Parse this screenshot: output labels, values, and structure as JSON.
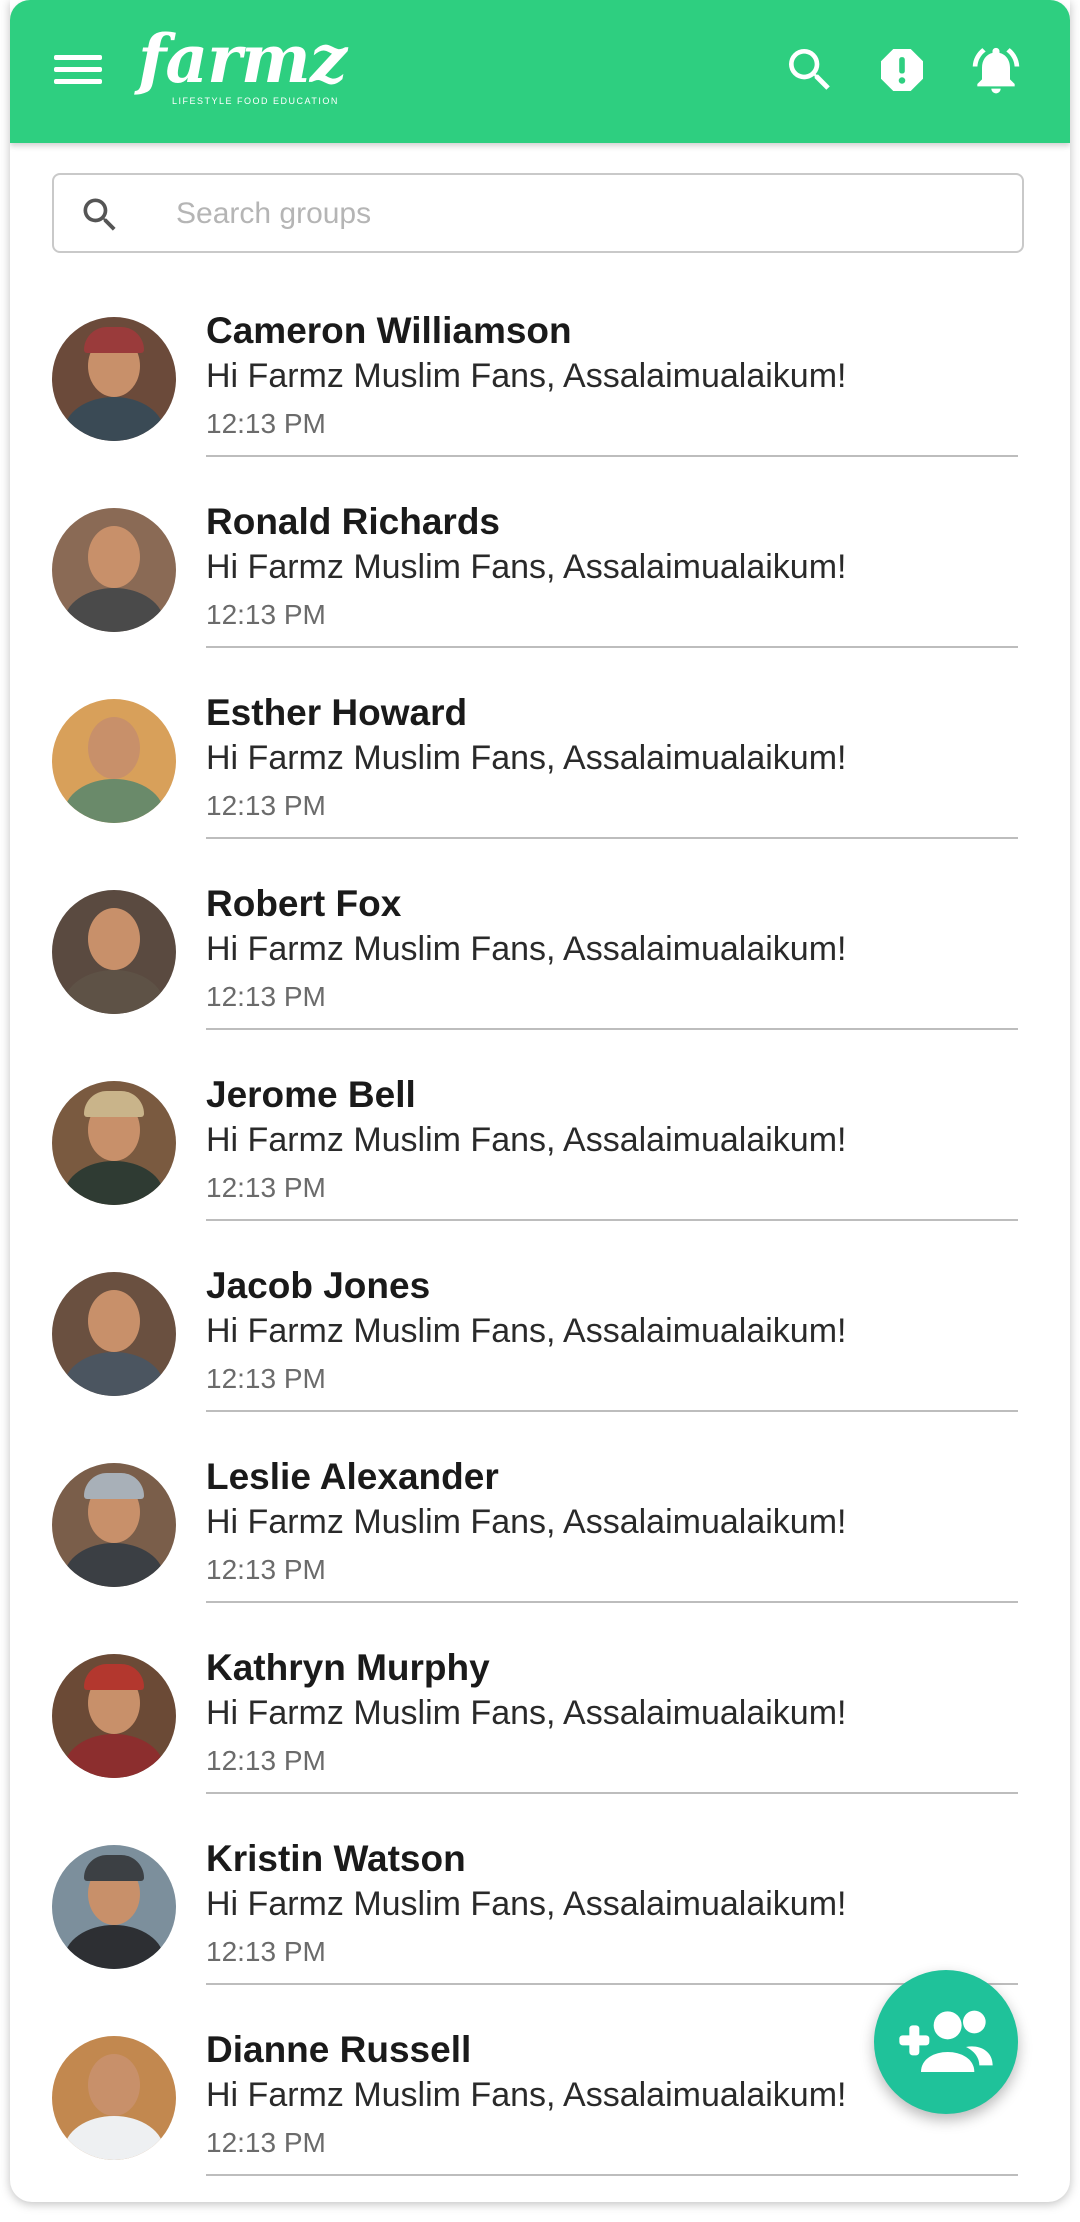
{
  "app": {
    "logo_text": "farmz",
    "logo_tagline": "LIFESTYLE FOOD EDUCATION"
  },
  "search": {
    "placeholder": "Search groups",
    "value": ""
  },
  "icons": {
    "menu": "menu-icon",
    "search": "search-icon",
    "report": "report-icon",
    "notifications": "bell-icon",
    "fab": "add-group-icon"
  },
  "colors": {
    "appbar": "#2ecf80",
    "fab": "#1fc29a"
  },
  "chats": [
    {
      "name": "Cameron Williamson",
      "message": "Hi Farmz Muslim Fans, Assalaimualaikum!",
      "time": "12:13 PM"
    },
    {
      "name": "Ronald Richards",
      "message": "Hi Farmz Muslim Fans, Assalaimualaikum!",
      "time": "12:13 PM"
    },
    {
      "name": "Esther Howard",
      "message": "Hi Farmz Muslim Fans, Assalaimualaikum!",
      "time": "12:13 PM"
    },
    {
      "name": "Robert Fox",
      "message": "Hi Farmz Muslim Fans, Assalaimualaikum!",
      "time": "12:13 PM"
    },
    {
      "name": "Jerome Bell",
      "message": "Hi Farmz Muslim Fans, Assalaimualaikum!",
      "time": "12:13 PM"
    },
    {
      "name": "Jacob Jones",
      "message": "Hi Farmz Muslim Fans, Assalaimualaikum!",
      "time": "12:13 PM"
    },
    {
      "name": "Leslie Alexander",
      "message": "Hi Farmz Muslim Fans, Assalaimualaikum!",
      "time": "12:13 PM"
    },
    {
      "name": "Kathryn Murphy",
      "message": "Hi Farmz Muslim Fans, Assalaimualaikum!",
      "time": "12:13 PM"
    },
    {
      "name": "Kristin Watson",
      "message": "Hi Farmz Muslim Fans, Assalaimualaikum!",
      "time": "12:13 PM"
    },
    {
      "name": "Dianne Russell",
      "message": "Hi Farmz Muslim Fans, Assalaimualaikum!",
      "time": "12:13 PM"
    }
  ]
}
